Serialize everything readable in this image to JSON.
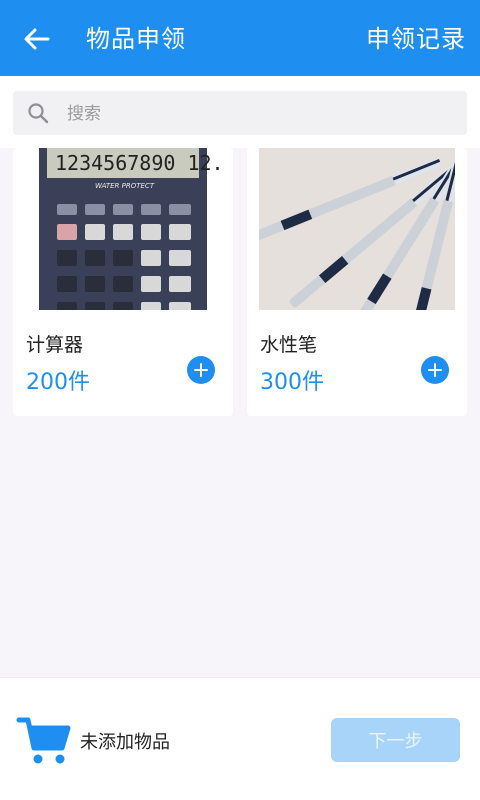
{
  "header": {
    "title": "物品申领",
    "action_label": "申领记录"
  },
  "search": {
    "placeholder": "搜索",
    "value": ""
  },
  "products": [
    {
      "name": "计算器",
      "qty": "200件",
      "image_icon": "calculator-image"
    },
    {
      "name": "水性笔",
      "qty": "300件",
      "image_icon": "pens-image"
    }
  ],
  "calculator_display": "1234567890 12.",
  "calculator_brand": "WATER PROTECT",
  "footer": {
    "cart_text": "未添加物品",
    "next_label": "下一步"
  },
  "colors": {
    "accent": "#1e8ff0",
    "next_disabled": "#a9d4fa"
  }
}
